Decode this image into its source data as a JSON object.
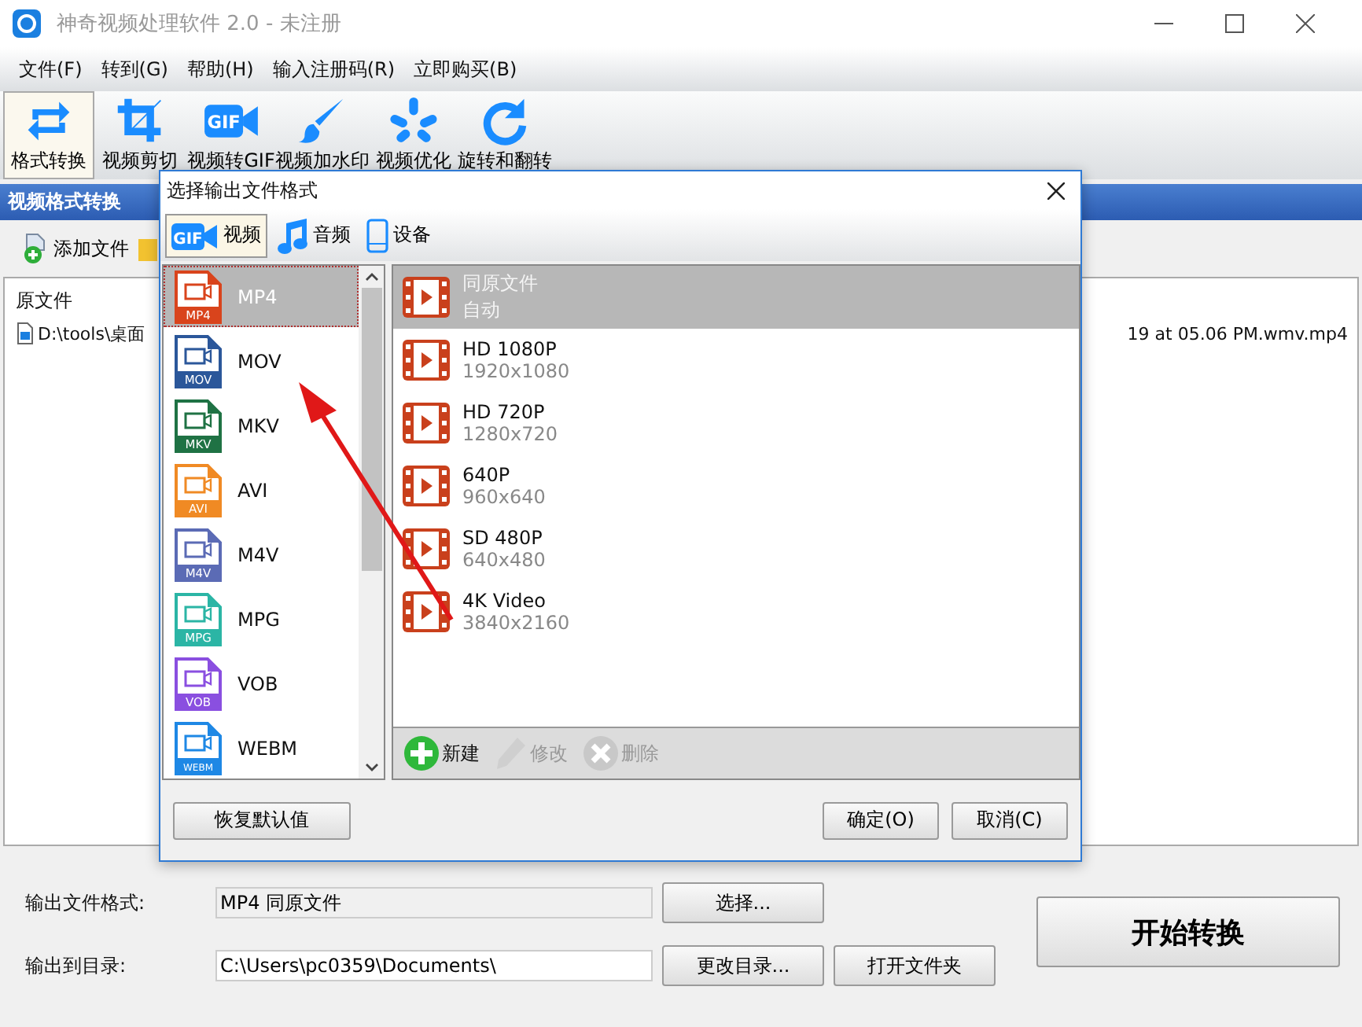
{
  "window": {
    "title": "神奇视频处理软件 2.0 - 未注册"
  },
  "menu": [
    "文件(F)",
    "转到(G)",
    "帮助(H)",
    "输入注册码(R)",
    "立即购买(B)"
  ],
  "toolbar": [
    {
      "label": "格式转换",
      "kind": "convert",
      "selected": true
    },
    {
      "label": "视频剪切",
      "kind": "crop",
      "selected": false
    },
    {
      "label": "视频转GIF",
      "kind": "gif",
      "badge": "GIF",
      "selected": false
    },
    {
      "label": "视频加水印",
      "kind": "brush",
      "selected": false
    },
    {
      "label": "视频优化",
      "kind": "sparkle",
      "selected": false
    },
    {
      "label": "旋转和翻转",
      "kind": "rotate",
      "selected": false
    }
  ],
  "section_title": "视频格式转换",
  "add_file": "添加文件",
  "file_list": {
    "column": "原文件",
    "rows": [
      {
        "path_start": "D:\\tools\\桌面",
        "path_end": "19 at 05.06 PM.wmv.mp4"
      }
    ]
  },
  "output": {
    "format_label": "输出文件格式:",
    "format_value": "MP4 同原文件",
    "choose": "选择...",
    "dir_label": "输出到目录:",
    "dir_value": "C:\\Users\\pc0359\\Documents\\",
    "change_dir": "更改目录...",
    "open_folder": "打开文件夹",
    "start": "开始转换"
  },
  "dialog": {
    "title": "选择输出文件格式",
    "tabs": [
      {
        "label": "视频",
        "kind": "gif",
        "badge": "GIF",
        "selected": true
      },
      {
        "label": "音频",
        "kind": "note",
        "selected": false
      },
      {
        "label": "设备",
        "kind": "phone",
        "selected": false
      }
    ],
    "formats": [
      {
        "name": "MP4",
        "badge": "MP4",
        "color": "#d9441c",
        "selected": true
      },
      {
        "name": "MOV",
        "badge": "MOV",
        "color": "#2b579a",
        "selected": false
      },
      {
        "name": "MKV",
        "badge": "MKV",
        "color": "#1f7244",
        "selected": false
      },
      {
        "name": "AVI",
        "badge": "AVI",
        "color": "#f08a24",
        "selected": false
      },
      {
        "name": "M4V",
        "badge": "M4V",
        "color": "#5b6bb5",
        "selected": false
      },
      {
        "name": "MPG",
        "badge": "MPG",
        "color": "#2bb5a5",
        "selected": false
      },
      {
        "name": "VOB",
        "badge": "VOB",
        "color": "#8a4fe0",
        "selected": false
      },
      {
        "name": "WEBM",
        "badge": "WEBM",
        "color": "#1e88e5",
        "selected": false
      }
    ],
    "presets": [
      {
        "name": "同原文件",
        "size": "自动",
        "selected": true
      },
      {
        "name": "HD 1080P",
        "size": "1920x1080",
        "selected": false
      },
      {
        "name": "HD 720P",
        "size": "1280x720",
        "selected": false
      },
      {
        "name": "640P",
        "size": "960x640",
        "selected": false
      },
      {
        "name": "SD 480P",
        "size": "640x480",
        "selected": false
      },
      {
        "name": "4K Video",
        "size": "3840x2160",
        "selected": false
      }
    ],
    "preset_actions": [
      {
        "label": "新建",
        "kind": "add",
        "disabled": false
      },
      {
        "label": "修改",
        "kind": "edit",
        "disabled": true
      },
      {
        "label": "删除",
        "kind": "delete",
        "disabled": true
      }
    ],
    "reset": "恢复默认值",
    "ok": "确定(O)",
    "cancel": "取消(C)"
  }
}
